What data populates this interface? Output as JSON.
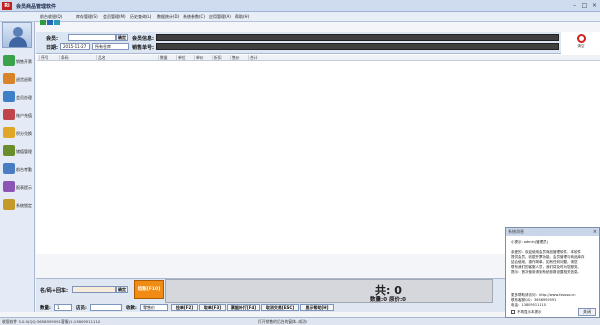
{
  "window": {
    "app_icon_text": "Ri",
    "title": "会员商品管理软件",
    "minimize": "–",
    "maximize": "□",
    "close": "×"
  },
  "menu": [
    {
      "label": "前台收银(Q)"
    },
    {
      "label": "库存管理(S)"
    },
    {
      "label": "会员管理(M)"
    },
    {
      "label": "历史查询(L)"
    },
    {
      "label": "数据统计(D)"
    },
    {
      "label": "系统参数(C)"
    },
    {
      "label": "应用管理(A)"
    },
    {
      "label": "帮助(H)"
    }
  ],
  "quick_icons": [
    {
      "icon": "green-square-icon",
      "color": "#2e9b3d"
    },
    {
      "icon": "blue-square-icon",
      "color": "#2a64b8"
    },
    {
      "icon": "cyan-square-icon",
      "color": "#2b9bb6"
    }
  ],
  "sidebar": {
    "avatar": "user-avatar-icon",
    "items": [
      {
        "label": "销售开票",
        "icon": "money-icon",
        "color": "#3aa24a"
      },
      {
        "label": "退货退款",
        "icon": "return-icon",
        "color": "#d9832a"
      },
      {
        "label": "会员办理",
        "icon": "member-icon",
        "color": "#3f7fc7"
      },
      {
        "label": "账户充值",
        "icon": "recharge-icon",
        "color": "#c0454a"
      },
      {
        "label": "积分兑换",
        "icon": "gift-icon",
        "color": "#e0a628"
      },
      {
        "label": "储值管理",
        "icon": "pen-icon",
        "color": "#6b8e2d"
      },
      {
        "label": "前台考勤",
        "icon": "attendance-icon",
        "color": "#4a7cc4"
      },
      {
        "label": "报表提示",
        "icon": "report-icon",
        "color": "#8a55b5"
      },
      {
        "label": "系统锁定",
        "icon": "lock-icon",
        "color": "#c49a2c"
      }
    ]
  },
  "form": {
    "member_label": "会员:",
    "member_value": "",
    "confirm_label": "确定",
    "member_info_label": "会员信息:",
    "date_label": "日期:",
    "date_value": "2015-11-27",
    "warehouse_value": "所有仓库",
    "sales_no_label": "销售单号:",
    "clear_label": "清空"
  },
  "grid": {
    "columns": [
      "序号",
      "条码",
      "品名",
      "数量",
      "单位",
      "单价",
      "折扣",
      "售价",
      "合计"
    ]
  },
  "bottom": {
    "barcode_label": "名/码+回车:",
    "barcode_confirm": "确定",
    "pay_label": "结账[F10]",
    "total_label": "共: 0",
    "qty_label": "数量:0 原价:0",
    "discount_label": "数量:",
    "discount_value": "1",
    "sales_person_label": "店员:",
    "sales_person_value": "",
    "pay_type_label": "收款:",
    "pay_type_value": "零售价",
    "fkeys": [
      {
        "label": "挂单[F2]"
      },
      {
        "label": "取单[F3]"
      },
      {
        "label": "票据补打[F4]"
      },
      {
        "label": "取消交易[ESC]"
      },
      {
        "label": "显示帮助[H]"
      }
    ]
  },
  "status": {
    "left": "收银软件 3.0.0(QQ:3656959591客服)1:13809511110",
    "middle": "打开销售的后台的窗体..成功!"
  },
  "popup": {
    "title": "系统消息",
    "close": "×",
    "lines": [
      "小提示: admin(管理员)",
      "",
      "亲爱的：欢迎使用会员商品管理软件，本软件",
      "提供会员、收银开票功能，会员管理与商品库存",
      "结合使用，操作简单。如有任何问题，请您",
      "联系我们的客服人员，我们将及时为您服务。",
      "提示：首次使用请到系统参数设置相关信息。",
      "",
      "",
      "",
      "更多帮助请访问：http://www.fxsoso.cn",
      "联系客服QQ：3656959591",
      "电话：13809511110"
    ],
    "checkbox_label": "不再显示本提示",
    "close_button": "关闭"
  }
}
